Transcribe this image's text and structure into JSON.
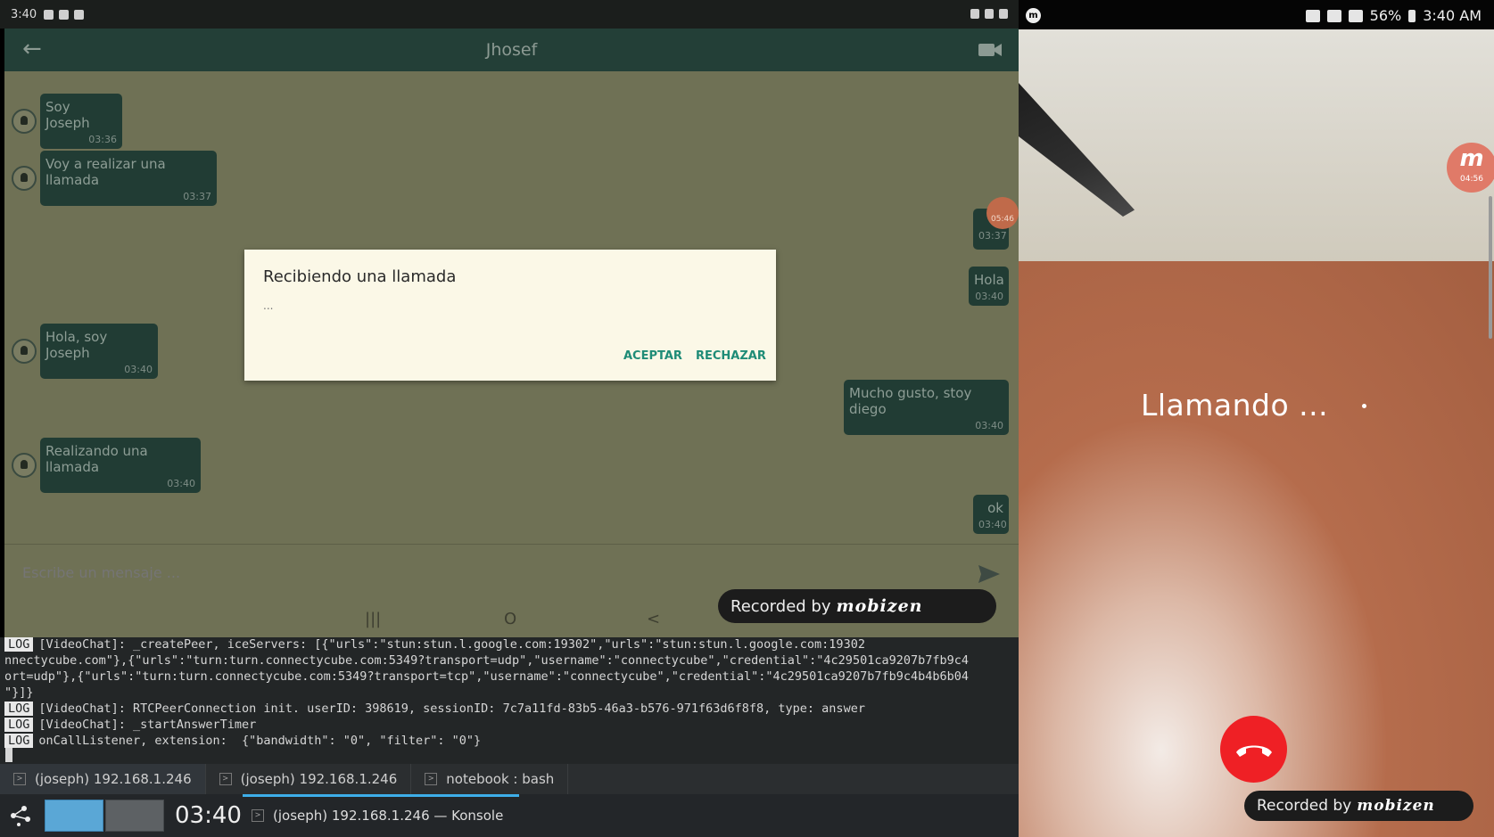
{
  "left_phone": {
    "status_time": "3:40",
    "chat_title": "Jhosef",
    "messages": [
      {
        "side": "in",
        "text": "Soy Joseph",
        "time": "03:36"
      },
      {
        "side": "in",
        "text": "Voy a realizar una llamada",
        "time": "03:37"
      },
      {
        "side": "out",
        "text": "",
        "time": "03:37"
      },
      {
        "side": "out",
        "text": "Hola",
        "time": "03:40"
      },
      {
        "side": "in",
        "text": "Hola, soy Joseph",
        "time": "03:40"
      },
      {
        "side": "out",
        "text": "Mucho gusto, stoy diego",
        "time": "03:40"
      },
      {
        "side": "in",
        "text": "Realizando una llamada",
        "time": "03:40"
      },
      {
        "side": "out",
        "text": "ok",
        "time": "03:40"
      }
    ],
    "dialog": {
      "title": "Recibiendo una llamada",
      "body": "...",
      "accept": "ACEPTAR",
      "reject": "RECHAZAR"
    },
    "input_placeholder": "Escribe un mensaje ...",
    "nav": {
      "recent": "|||",
      "home": "O",
      "back": "<"
    },
    "mobizen_time": "05:46",
    "recorded_by": "Recorded by",
    "recorded_logo": "mobizen"
  },
  "terminal": {
    "lines": [
      {
        "tag": "LOG",
        "text": "[VideoChat]: _createPeer, iceServers: [{\"urls\":\"stun:stun.l.google.com:19302\",\"urls\":\"stun:stun.l.google.com:19302"
      },
      {
        "tag": "",
        "text": "nnectycube.com\"},{\"urls\":\"turn:turn.connectycube.com:5349?transport=udp\",\"username\":\"connectycube\",\"credential\":\"4c29501ca9207b7fb9c4"
      },
      {
        "tag": "",
        "text": "ort=udp\"},{\"urls\":\"turn:turn.connectycube.com:5349?transport=tcp\",\"username\":\"connectycube\",\"credential\":\"4c29501ca9207b7fb9c4b4b6b04"
      },
      {
        "tag": "",
        "text": "\"}]}"
      },
      {
        "tag": "LOG",
        "text": "[VideoChat]: RTCPeerConnection init. userID: 398619, sessionID: 7c7a11fd-83b5-46a3-b576-971f63d6f8f8, type: answer"
      },
      {
        "tag": "LOG",
        "text": "[VideoChat]: _startAnswerTimer"
      },
      {
        "tag": "LOG",
        "text": "onCallListener, extension:  {\"bandwidth\": \"0\", \"filter\": \"0\"}"
      }
    ],
    "tabs": [
      {
        "label": "(joseph) 192.168.1.246",
        "active": true
      },
      {
        "label": "(joseph) 192.168.1.246",
        "active": false
      },
      {
        "label": "notebook : bash",
        "active": false
      }
    ]
  },
  "taskbar": {
    "clock": "03:40",
    "task_label": "(joseph) 192.168.1.246 — Konsole"
  },
  "right_phone": {
    "battery": "56%",
    "time": "3:40 AM",
    "calling_text": "Llamando ...",
    "mobizen_time": "04:56",
    "recorded_by": "Recorded by",
    "recorded_logo": "mobizen"
  }
}
